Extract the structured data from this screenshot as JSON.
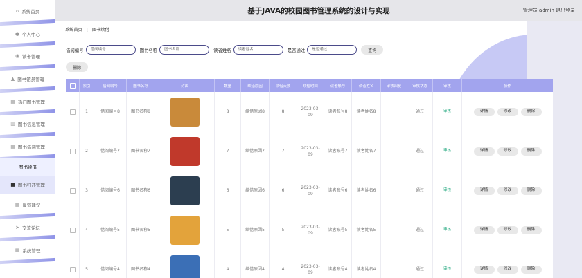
{
  "header": {
    "title": "基于JAVA的校园图书管理系统的设计与实现",
    "user": "管理员 admin",
    "logout": "退出登录"
  },
  "sidebar": {
    "items": [
      {
        "label": "系统首页",
        "icon": "home-icon"
      },
      {
        "label": "个人中心",
        "icon": "user-icon"
      },
      {
        "label": "读者管理",
        "icon": "reader-icon"
      },
      {
        "label": "图书馆员管理",
        "icon": "person-icon"
      },
      {
        "label": "热门图书管理",
        "icon": "grid-icon"
      },
      {
        "label": "图书信息管理",
        "icon": "chart-icon"
      },
      {
        "label": "图书借阅管理",
        "icon": "grid-icon"
      },
      {
        "label": "图书续借",
        "icon": ""
      },
      {
        "label": "图书归还管理",
        "icon": "book-icon"
      },
      {
        "label": "反馈建议",
        "icon": "grid-icon"
      },
      {
        "label": "交流论坛",
        "icon": "send-icon"
      },
      {
        "label": "系统管理",
        "icon": "grid-icon"
      }
    ]
  },
  "breadcrumb": {
    "home": "系统首页",
    "sep": "⋮",
    "current": "图书续借"
  },
  "filters": {
    "f1": {
      "label": "借阅编号",
      "placeholder": "借阅编号"
    },
    "f2": {
      "label": "图书名称",
      "placeholder": "图书名称"
    },
    "f3": {
      "label": "读者姓名",
      "placeholder": "读者姓名"
    },
    "f4": {
      "label": "是否通过",
      "placeholder": "是否通过"
    },
    "search": "查询",
    "delete": "删除"
  },
  "table": {
    "headers": [
      "",
      "索引",
      "借阅编号",
      "图书名称",
      "封面",
      "数量",
      "续借原因",
      "续借天数",
      "续借时间",
      "读者账号",
      "读者姓名",
      "审核回复",
      "审核状态",
      "审核",
      "操作"
    ],
    "rows": [
      {
        "index": "1",
        "borrow_no": "借阅编号8",
        "book": "图书名称8",
        "qty": "8",
        "reason": "续借原因8",
        "days": "8",
        "time": "2023-03-09",
        "account": "读者账号8",
        "name": "读者姓名8",
        "reply": "",
        "status": "通过",
        "audit": "审核",
        "cover_color": "#c98a3a"
      },
      {
        "index": "2",
        "borrow_no": "借阅编号7",
        "book": "图书名称7",
        "qty": "7",
        "reason": "续借原因7",
        "days": "7",
        "time": "2023-03-09",
        "account": "读者账号7",
        "name": "读者姓名7",
        "reply": "",
        "status": "通过",
        "audit": "审核",
        "cover_color": "#c0392b"
      },
      {
        "index": "3",
        "borrow_no": "借阅编号6",
        "book": "图书名称6",
        "qty": "6",
        "reason": "续借原因6",
        "days": "6",
        "time": "2023-03-09",
        "account": "读者账号6",
        "name": "读者姓名6",
        "reply": "",
        "status": "通过",
        "audit": "审核",
        "cover_color": "#2c3e50"
      },
      {
        "index": "4",
        "borrow_no": "借阅编号5",
        "book": "图书名称5",
        "qty": "5",
        "reason": "续借原因5",
        "days": "5",
        "time": "2023-03-09",
        "account": "读者账号5",
        "name": "读者姓名5",
        "reply": "",
        "status": "通过",
        "audit": "审核",
        "cover_color": "#e3a33b"
      },
      {
        "index": "5",
        "borrow_no": "借阅编号4",
        "book": "图书名称4",
        "qty": "4",
        "reason": "续借原因4",
        "days": "4",
        "time": "2023-03-09",
        "account": "读者账号4",
        "name": "读者姓名4",
        "reply": "",
        "status": "通过",
        "audit": "审核",
        "cover_color": "#3b6fb6"
      }
    ],
    "actions": {
      "detail": "详情",
      "edit": "修改",
      "delete": "删除"
    }
  }
}
